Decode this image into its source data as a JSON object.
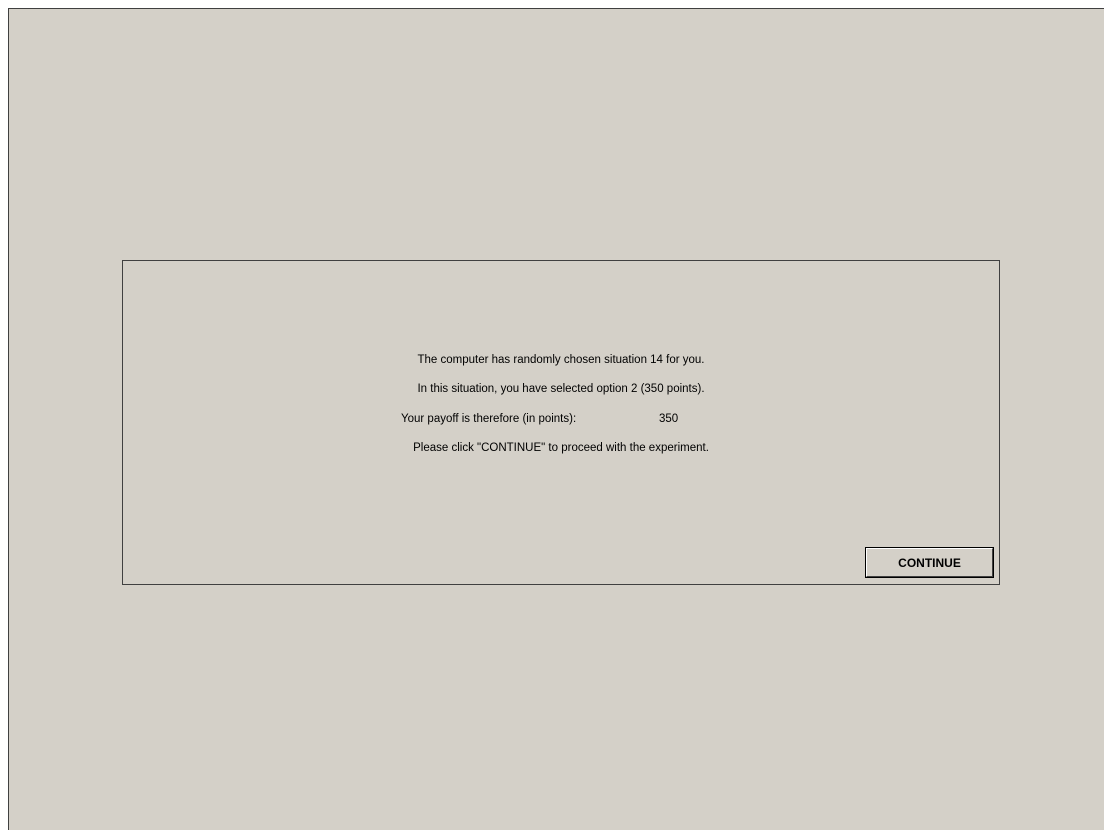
{
  "dialog": {
    "line_1": "The computer has randomly chosen situation 14 for you.",
    "line_2": "In this situation, you have selected option 2 (350 points).",
    "payoff_label": "Your payoff is therefore (in points):",
    "payoff_value": "350",
    "line_4": "Please click \"CONTINUE\" to proceed with the experiment.",
    "continue_label": "CONTINUE"
  },
  "colors": {
    "background": "#d4d0c8",
    "border": "#404040"
  }
}
